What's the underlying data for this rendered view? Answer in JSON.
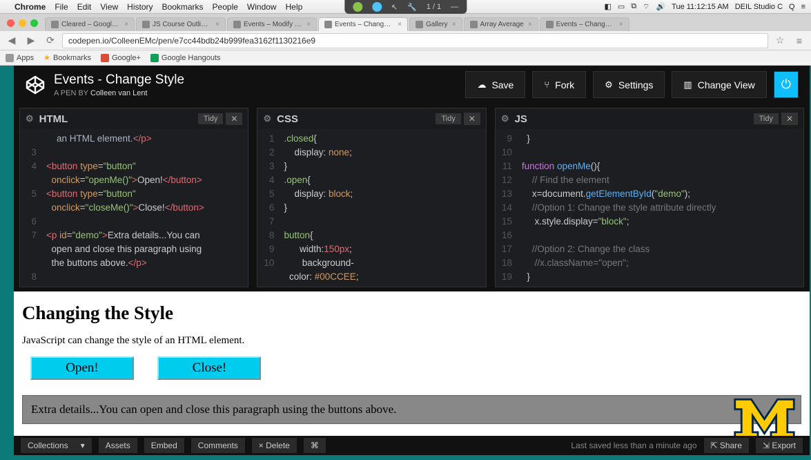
{
  "mac_menu": {
    "app": "Chrome",
    "items": [
      "File",
      "Edit",
      "View",
      "History",
      "Bookmarks",
      "People",
      "Window",
      "Help"
    ],
    "right_time": "Tue 11:12:15 AM",
    "right_label": "DEIL Studio C"
  },
  "float_pager": "1 / 1",
  "chrome": {
    "tabs": [
      {
        "label": "Cleared – Google Drive",
        "active": false
      },
      {
        "label": "JS Course Outline – Goog",
        "active": false
      },
      {
        "label": "Events – Modify The DOM",
        "active": false
      },
      {
        "label": "Events – Change Style",
        "active": true
      },
      {
        "label": "Gallery",
        "active": false
      },
      {
        "label": "Array Average",
        "active": false
      },
      {
        "label": "Events – Change Style",
        "active": false
      }
    ],
    "address": "codepen.io/ColleenEMc/pen/e7cc44bdb24b999fea3162f1130216e9",
    "bookmarks": [
      "Apps",
      "Bookmarks",
      "Google+",
      "Google Hangouts"
    ]
  },
  "codepen": {
    "title": "Events - Change Style",
    "sub_prefix": "A PEN BY ",
    "author": "Colleen van Lent",
    "actions": {
      "save": "Save",
      "fork": "Fork",
      "settings": "Settings",
      "changeview": "Change View"
    },
    "panels": {
      "html": {
        "title": "HTML",
        "tidy": "Tidy"
      },
      "css": {
        "title": "CSS",
        "tidy": "Tidy"
      },
      "js": {
        "title": "JS",
        "tidy": "Tidy"
      }
    },
    "html_code": {
      "l2": "    an HTML element.</p>",
      "l4a": "<button type=\"button\"",
      "l4b": "  onclick=\"openMe()\">Open!</button>",
      "l5a": "<button type=\"button\"",
      "l5b": "  onclick=\"closeMe()\">Close!</button>",
      "l7a": "<p id=\"demo\">Extra details...You can",
      "l7b": "  open and close this paragraph using",
      "l7c": "  the buttons above.</p>"
    },
    "css_code": {
      "l1": ".closed{",
      "l2": "    display: none;",
      "l3": "}",
      "l4": ".open{",
      "l5": "    display: block;",
      "l6": "}",
      "l8": "button{",
      "l9": "      width:150px;",
      "l10": "       background-",
      "l11": "  color: #00CCEE;"
    },
    "js_code": {
      "l9": "  }",
      "l11": "function openMe(){",
      "l12": "    // Find the element",
      "l13": "    x=document.getElementById(\"demo\");",
      "l14": "    //Option 1: Change the style attribute directly",
      "l15": "     x.style.display=\"block\";",
      "l17": "    //Option 2: Change the class",
      "l18": "     //x.className=\"open\";",
      "l19": "  }"
    },
    "footer": {
      "collections": "Collections",
      "assets": "Assets",
      "embed": "Embed",
      "comments": "Comments",
      "delete": "× Delete",
      "saved": "Last saved less than a minute ago",
      "share": "Share",
      "export": "Export"
    }
  },
  "preview": {
    "heading": "Changing the Style",
    "text": "JavaScript can change the style of an HTML element.",
    "open": "Open!",
    "close": "Close!",
    "demo": "Extra details...You can open and close this paragraph using the buttons above."
  }
}
